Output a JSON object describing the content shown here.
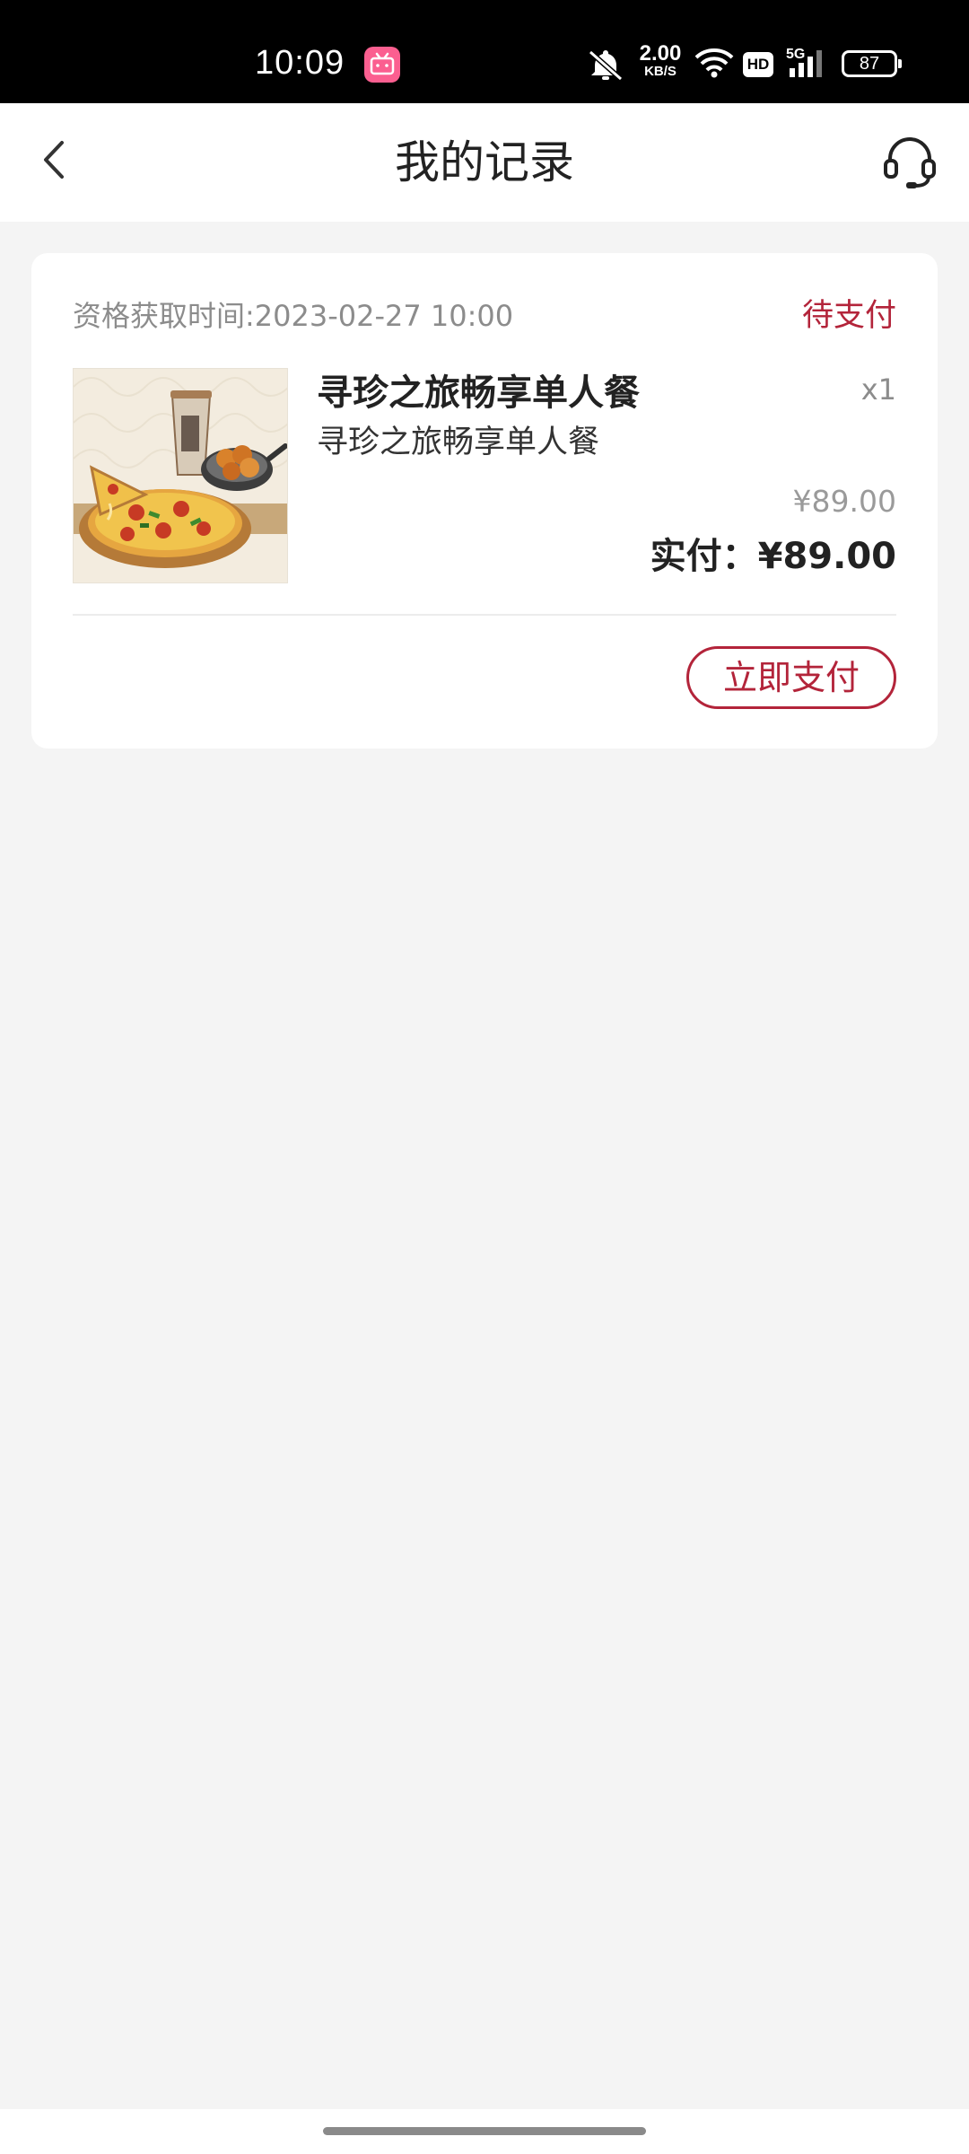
{
  "status_bar": {
    "time": "10:09",
    "net_speed_value": "2.00",
    "net_speed_unit": "KB/S",
    "hd_label": "HD",
    "network_label": "5G",
    "battery": "87",
    "app_icon": "bilibili-icon",
    "icons": [
      "mute-icon",
      "wifi-icon",
      "signal-icon",
      "battery-icon"
    ]
  },
  "header": {
    "title": "我的记录",
    "back_icon": "chevron-left-icon",
    "service_icon": "headset-icon"
  },
  "record": {
    "time_label": "资格获取时间:2023-02-27 10:00",
    "status": "待支付",
    "product_title": "寻珍之旅畅享单人餐",
    "product_subtitle": "寻珍之旅畅享单人餐",
    "quantity": "x1",
    "original_price": "¥89.00",
    "paid_amount": "实付：¥89.00",
    "pay_button": "立即支付",
    "image_description_icon": "pizza-meal-image"
  },
  "colors": {
    "accent": "#b3243a",
    "background": "#f4f4f4",
    "status_bar": "#000000",
    "bilibili_pink": "#fb5f90"
  }
}
